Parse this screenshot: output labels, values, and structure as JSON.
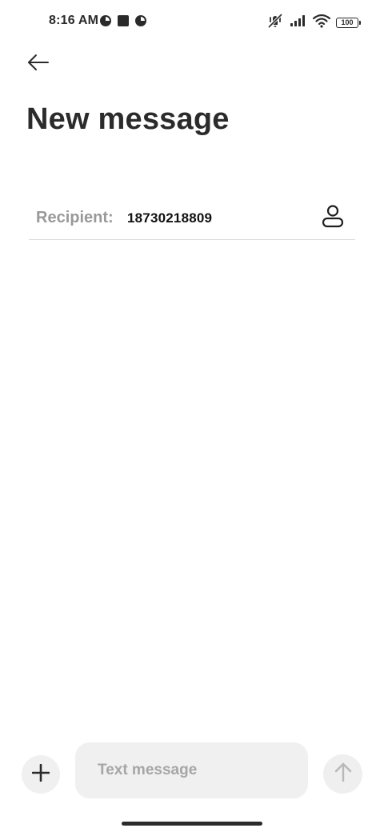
{
  "status_bar": {
    "time": "8:16 AM",
    "left_icons": [
      "pie-app-icon",
      "square-app-icon",
      "pie-app-icon"
    ],
    "right_icons": [
      "mute-vibrate-icon",
      "signal-icon",
      "wifi-icon"
    ],
    "battery": "100"
  },
  "header": {
    "back_icon": "arrow-left-icon",
    "title": "New message"
  },
  "recipient": {
    "label": "Recipient:",
    "value": "18730218809",
    "contact_icon": "contact-icon"
  },
  "composer": {
    "attach_icon": "plus-icon",
    "placeholder": "Text message",
    "value": "",
    "send_icon": "arrow-up-icon"
  }
}
